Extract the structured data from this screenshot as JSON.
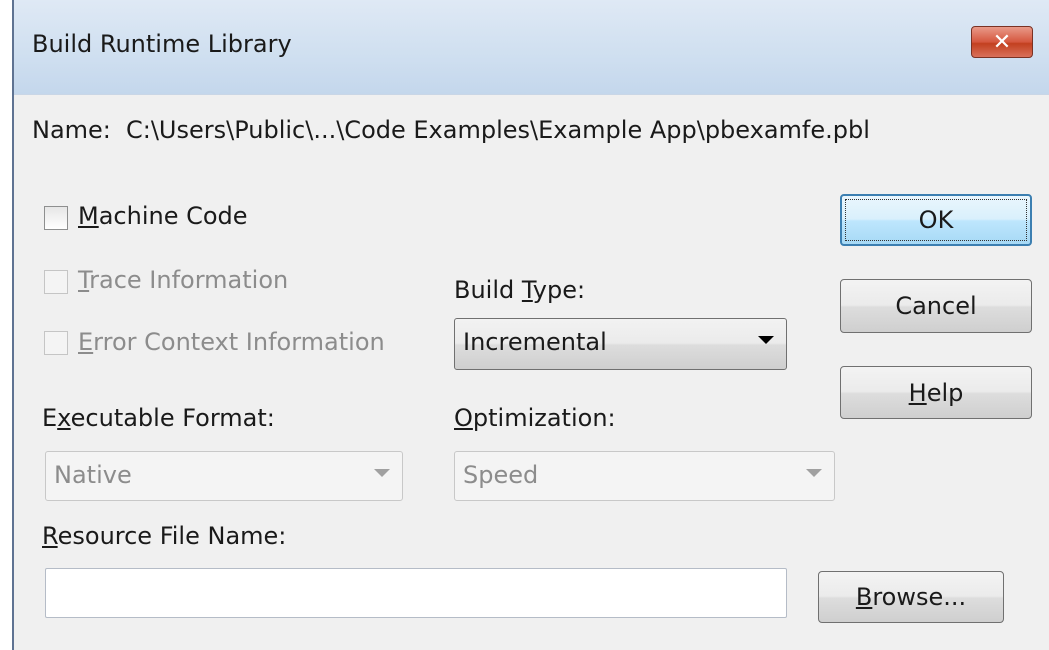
{
  "window": {
    "title": "Build Runtime Library",
    "close_icon": "close-x-icon"
  },
  "name_row": {
    "label": "Name:",
    "path": "C:\\Users\\Public\\...\\Code Examples\\Example App\\pbexamfe.pbl"
  },
  "options": {
    "machine_code": {
      "pre": "",
      "accel": "M",
      "post": "achine Code",
      "checked": false,
      "enabled": true
    },
    "trace_info": {
      "pre": "",
      "accel": "T",
      "post": "race Information",
      "checked": false,
      "enabled": false
    },
    "error_context": {
      "pre": "",
      "accel": "E",
      "post": "rror Context Information",
      "checked": false,
      "enabled": false
    }
  },
  "build_type": {
    "label_pre": "Build ",
    "label_accel": "T",
    "label_post": "ype:",
    "value": "Incremental"
  },
  "executable_format": {
    "label_pre": "E",
    "label_accel": "x",
    "label_post": "ecutable Format:",
    "value": "Native",
    "enabled": false
  },
  "optimization": {
    "label_pre": "",
    "label_accel": "O",
    "label_post": "ptimization:",
    "value": "Speed",
    "enabled": false
  },
  "resource_file": {
    "label_pre": "",
    "label_accel": "R",
    "label_post": "esource File Name:",
    "value": ""
  },
  "buttons": {
    "ok": "OK",
    "cancel": "Cancel",
    "help_accel": "H",
    "help_post": "elp",
    "browse_accel": "B",
    "browse_post": "rowse..."
  }
}
